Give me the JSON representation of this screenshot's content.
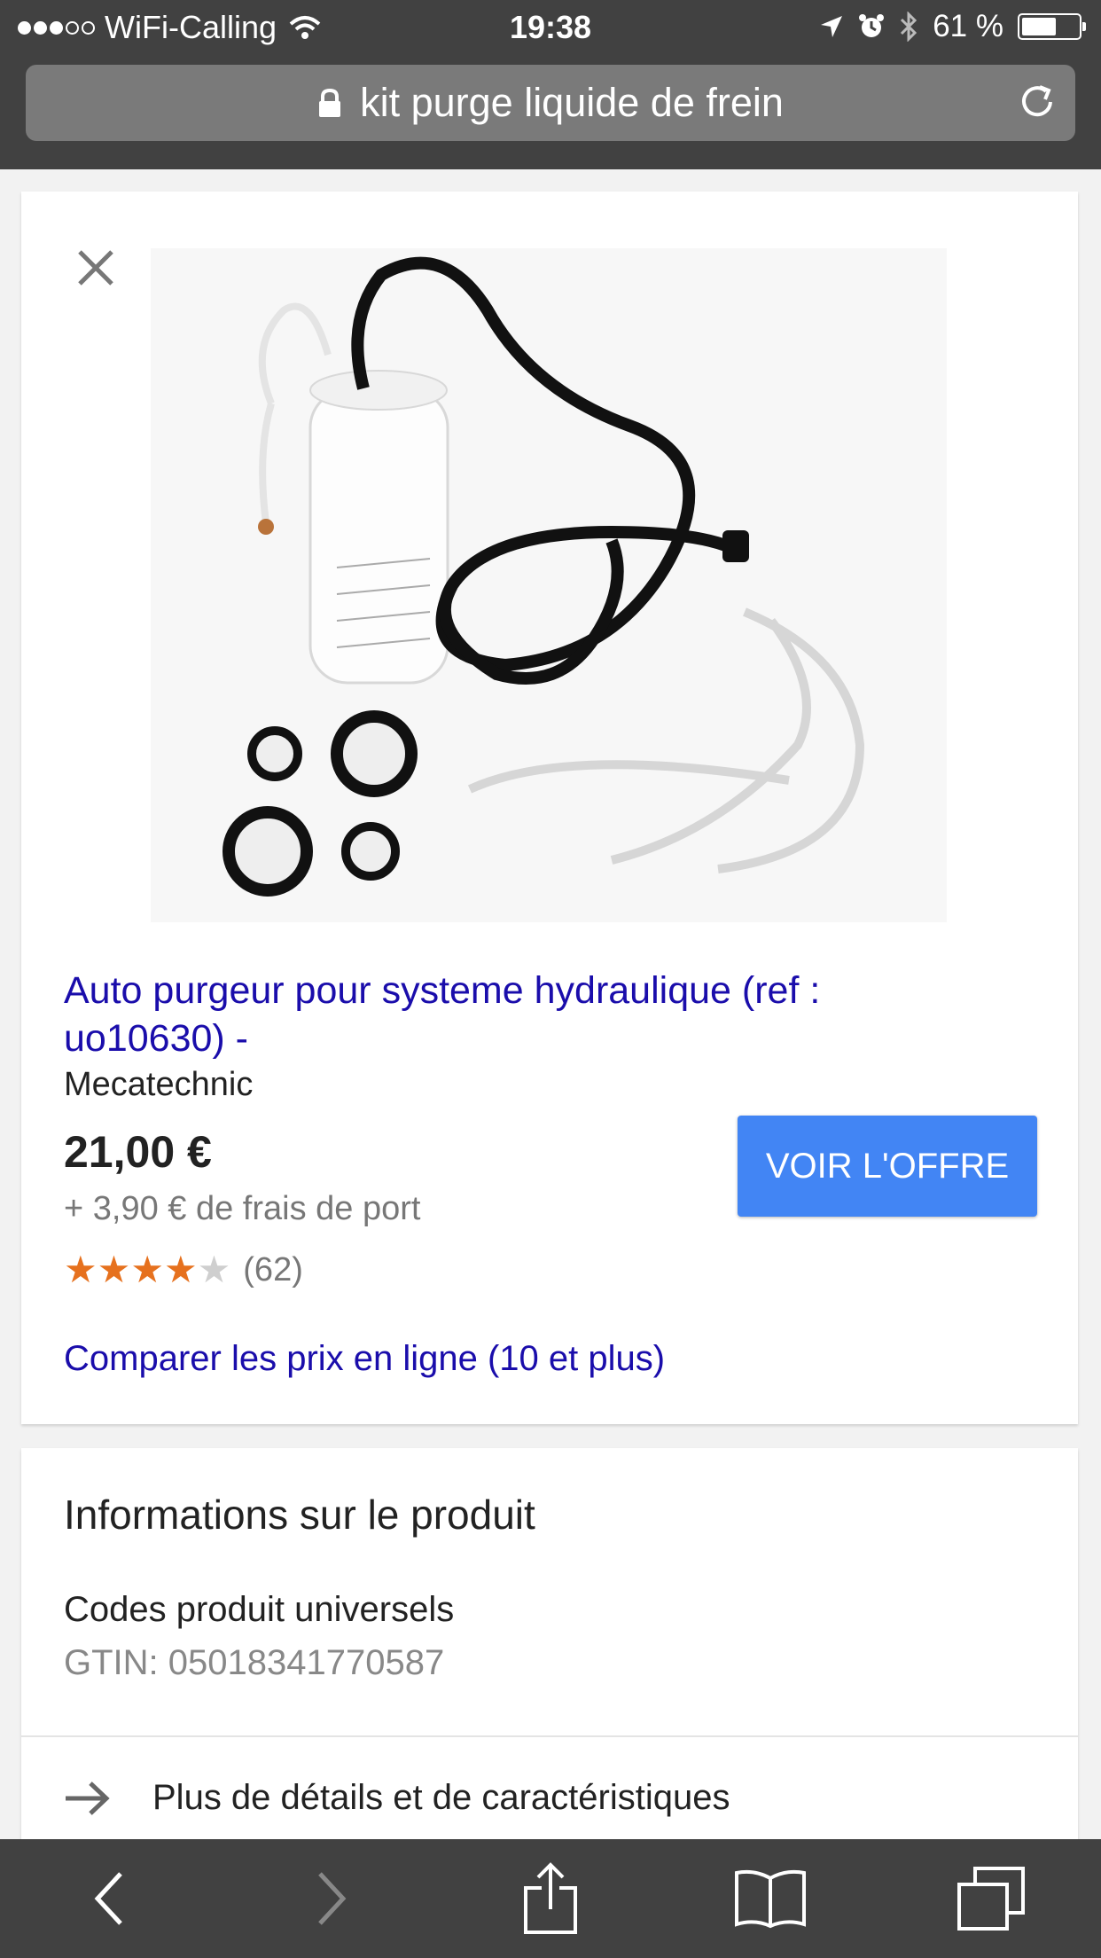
{
  "status_bar": {
    "carrier": "WiFi-Calling",
    "time": "19:38",
    "battery": "61 %",
    "battery_level": 0.61,
    "signal_dots": 5,
    "signal_filled": 3
  },
  "url_bar": {
    "text": "kit purge liquide de frein",
    "icons": [
      "lock-icon",
      "reload-icon"
    ]
  },
  "product": {
    "close_icon": "close-icon",
    "title": "Auto purgeur pour systeme hydraulique (ref : uo10630) -",
    "merchant": "Mecatechnic",
    "price": "21,00 €",
    "shipping": "+ 3,90 € de frais de port",
    "rating": 4,
    "rating_max": 5,
    "reviews": "(62)",
    "offer_button": "VOIR L'OFFRE",
    "compare_link": "Comparer les prix en ligne (10 et plus)"
  },
  "info": {
    "title": "Informations sur le produit",
    "codes_label": "Codes produit universels",
    "gtin": "GTIN: 05018341770587",
    "details_link": "Plus de détails et de caractéristiques"
  },
  "toolbar": {
    "icons": [
      "back-icon",
      "forward-icon",
      "share-icon",
      "bookmarks-icon",
      "tabs-icon"
    ]
  },
  "colors": {
    "chrome": "#414141",
    "link": "#1a0dab",
    "button": "#4285f4",
    "star": "#e6711e"
  }
}
